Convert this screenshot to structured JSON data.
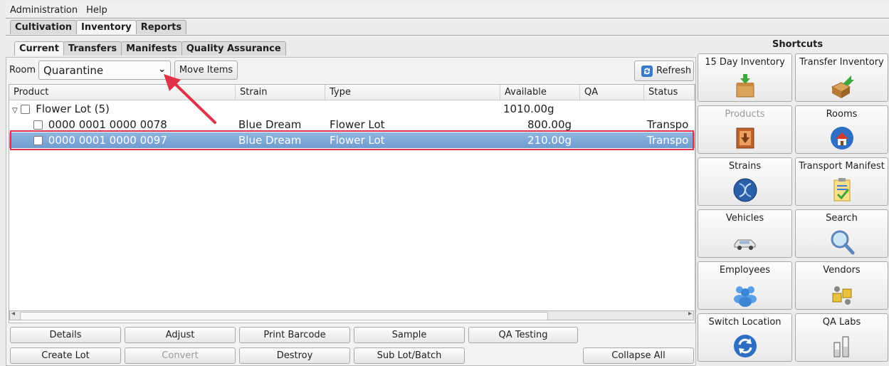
{
  "menu": [
    "Administration",
    "Help"
  ],
  "top_tabs": [
    {
      "label": "Cultivation"
    },
    {
      "label": "Inventory"
    },
    {
      "label": "Reports"
    }
  ],
  "sub_tabs": [
    {
      "label": "Current"
    },
    {
      "label": "Transfers"
    },
    {
      "label": "Manifests"
    },
    {
      "label": "Quality Assurance"
    }
  ],
  "toolbar": {
    "room_label": "Room",
    "room_value": "Quarantine",
    "move_items": "Move Items",
    "refresh": "Refresh"
  },
  "columns": [
    "Product",
    "Strain",
    "Type",
    "Available",
    "QA",
    "Status"
  ],
  "rows": [
    {
      "product": "Flower Lot (5)",
      "strain": "",
      "type": "",
      "available": "1010.00g",
      "status": "",
      "group": true,
      "selected": false
    },
    {
      "product": "0000 0001 0000 0078",
      "strain": "Blue Dream",
      "type": "Flower Lot",
      "available": "800.00g",
      "status": "Transpo",
      "group": false,
      "selected": false
    },
    {
      "product": "0000 0001 0000 0097",
      "strain": "Blue Dream",
      "type": "Flower Lot",
      "available": "210.00g",
      "status": "Transpo",
      "group": false,
      "selected": true
    }
  ],
  "buttons_row1": [
    "Details",
    "Adjust",
    "Print Barcode",
    "Sample",
    "QA Testing"
  ],
  "buttons_row2": [
    "Create Lot",
    "Convert",
    "Destroy",
    "Sub Lot/Batch",
    "Collapse All"
  ],
  "shortcuts": {
    "title": "Shortcuts",
    "items": [
      {
        "label": "15 Day Inventory",
        "icon": "inventory-box-icon",
        "enabled": true
      },
      {
        "label": "Transfer Inventory",
        "icon": "transfer-box-icon",
        "enabled": true
      },
      {
        "label": "Products",
        "icon": "products-icon",
        "enabled": false
      },
      {
        "label": "Rooms",
        "icon": "rooms-house-icon",
        "enabled": true
      },
      {
        "label": "Strains",
        "icon": "strains-dna-icon",
        "enabled": true
      },
      {
        "label": "Transport Manifest",
        "icon": "manifest-clipboard-icon",
        "enabled": true
      },
      {
        "label": "Vehicles",
        "icon": "car-icon",
        "enabled": true
      },
      {
        "label": "Search",
        "icon": "magnifier-icon",
        "enabled": true
      },
      {
        "label": "Employees",
        "icon": "people-icon",
        "enabled": true
      },
      {
        "label": "Vendors",
        "icon": "vendors-icon",
        "enabled": true
      },
      {
        "label": "Switch Location",
        "icon": "switch-location-icon",
        "enabled": true
      },
      {
        "label": "QA Labs",
        "icon": "qa-labs-icon",
        "enabled": true
      }
    ]
  },
  "colors": {
    "selection": "#7aa6d6",
    "highlight_border": "#e0334a",
    "arrow": "#e0334a"
  }
}
